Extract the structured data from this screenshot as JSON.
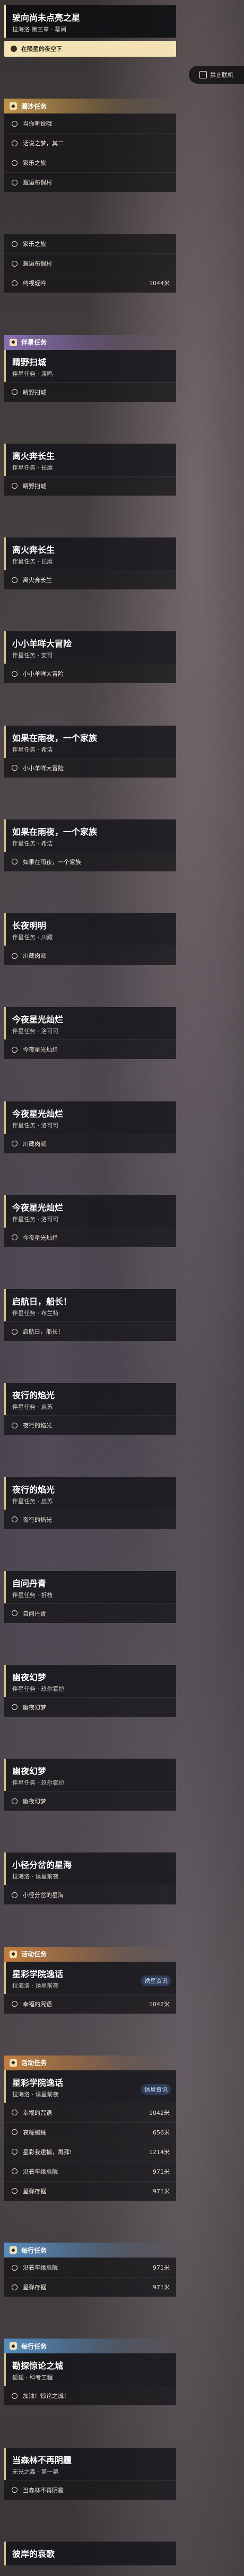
{
  "colors": {
    "accent_gold": "#d9c08a",
    "track_button": "#f3e3b4",
    "header_main": "#e0a94e",
    "header_companion": "#9b7ad0",
    "header_event": "#e08a3a",
    "header_daily": "#5aa0e0"
  },
  "sidebar": {
    "disable_connection_label": "禁止联机"
  },
  "sections": [
    {
      "quest": {
        "title": "驶向尚未点亮之星",
        "sub": "拉海洛 第三章 · 幕间",
        "selected": true
      },
      "track_label": "在陨星的夜空下",
      "objectives": []
    },
    {
      "header": "漏沙任务",
      "header_color": "#e0a94e",
      "objectives": [
        {
          "label": "当你听说哦",
          "dist": ""
        },
        {
          "label": "话说之梦，其二",
          "dist": ""
        },
        {
          "label": "家乐之旅",
          "dist": ""
        },
        {
          "label": "邂逅布偶村",
          "dist": ""
        }
      ]
    },
    {
      "objectives": [
        {
          "label": "家乐之旅",
          "dist": ""
        },
        {
          "label": "邂逅布偶村",
          "dist": ""
        },
        {
          "label": "终视轻吟",
          "dist": "1044米"
        }
      ]
    },
    {
      "header": "伴星任务",
      "header_color": "#9b7ad0",
      "quest": {
        "title": "睛野扫城",
        "sub": "伴星任务 · 渡鸣"
      },
      "objectives": [
        {
          "label": "睛野扫城",
          "dist": ""
        }
      ]
    },
    {
      "quest": {
        "title": "离火奔长生",
        "sub": "伴星任务 · 长鹰"
      },
      "objectives": [
        {
          "label": "睛野扫城",
          "dist": ""
        }
      ]
    },
    {
      "quest": {
        "title": "离火奔长生",
        "sub": "伴星任务 · 长鹰"
      },
      "objectives": [
        {
          "label": "离火奔长生",
          "dist": ""
        }
      ]
    },
    {
      "quest": {
        "title": "小小羊咩大冒险",
        "sub": "伴星任务 · 安可"
      },
      "objectives": [
        {
          "label": "小小羊咩大冒险",
          "dist": ""
        }
      ]
    },
    {
      "quest": {
        "title": "如果在雨夜，一个家族",
        "sub": "伴星任务 · 希洁"
      },
      "objectives": [
        {
          "label": "小小羊咩大冒险",
          "dist": ""
        }
      ]
    },
    {
      "quest": {
        "title": "如果在雨夜，一个家族",
        "sub": "伴星任务 · 希洁"
      },
      "objectives": [
        {
          "label": "如果在雨夜，一个家族",
          "dist": ""
        }
      ]
    },
    {
      "quest": {
        "title": "长夜明明",
        "sub": "伴星任务 · 川藏"
      },
      "objectives": [
        {
          "label": "川藏肉派",
          "dist": ""
        }
      ]
    },
    {
      "quest": {
        "title": "今夜星光灿烂",
        "sub": "伴星任务 · 洛可可"
      },
      "objectives": [
        {
          "label": "今夜星光灿烂",
          "dist": ""
        }
      ]
    },
    {
      "quest": {
        "title": "今夜星光灿烂",
        "sub": "伴星任务 · 洛可可"
      },
      "objectives": [
        {
          "label": "川藏肉派",
          "dist": ""
        }
      ]
    },
    {
      "quest": {
        "title": "今夜星光灿烂",
        "sub": "伴星任务 · 洛可可"
      },
      "objectives": [
        {
          "label": "今夜星光灿烂",
          "dist": ""
        }
      ]
    },
    {
      "quest": {
        "title": "启航日，船长！",
        "sub": "伴星任务 · 布兰特"
      },
      "objectives": [
        {
          "label": "启航日，船长！",
          "dist": ""
        }
      ]
    },
    {
      "quest": {
        "title": "夜行的焰光",
        "sub": "伴星任务 · 启苏"
      },
      "objectives": [
        {
          "label": "夜行的焰光",
          "dist": ""
        }
      ]
    },
    {
      "quest": {
        "title": "夜行的焰光",
        "sub": "伴星任务 · 启苏"
      },
      "objectives": [
        {
          "label": "夜行的焰光",
          "dist": ""
        }
      ]
    },
    {
      "quest": {
        "title": "自问丹青",
        "sub": "伴星任务 · 折枝"
      },
      "objectives": [
        {
          "label": "自问丹青",
          "dist": ""
        }
      ]
    },
    {
      "quest": {
        "title": "幽夜幻梦",
        "sub": "伴星任务 · 玖尔霍拉"
      },
      "objectives": [
        {
          "label": "幽夜幻梦",
          "dist": ""
        }
      ]
    },
    {
      "quest": {
        "title": "幽夜幻梦",
        "sub": "伴星任务 · 玖尔霍拉"
      },
      "objectives": [
        {
          "label": "幽夜幻梦",
          "dist": ""
        }
      ]
    },
    {
      "quest": {
        "title": "小径分岔的星海",
        "sub": "拉海洛 · 诱星前夜"
      },
      "objectives": [
        {
          "label": "小径分岔的星海",
          "dist": ""
        }
      ]
    },
    {
      "header": "活动任务",
      "header_color": "#e08a3a",
      "quest": {
        "title": "星彩学院逸话",
        "sub": "拉海洛 · 诱星前夜",
        "badge": "诱星资讯"
      },
      "objectives": [
        {
          "label": "幸福的咒语",
          "dist": "1042米"
        }
      ]
    },
    {
      "header": "活动任务",
      "header_color": "#e08a3a",
      "quest": {
        "title": "星彩学院逸话",
        "sub": "拉海洛 · 诱星前夜",
        "badge": "诱星资讯"
      },
      "objectives": [
        {
          "label": "幸福的咒语",
          "dist": "1042米"
        },
        {
          "label": "哀嚎蜘蛛",
          "dist": "656米"
        },
        {
          "label": "星彩我逮捕，再拜!",
          "dist": "1214米"
        },
        {
          "label": "沿着年缘启航",
          "dist": "971米"
        },
        {
          "label": "星弹存据",
          "dist": "971米"
        }
      ]
    },
    {
      "header": "每行任务",
      "header_color": "#5aa0e0",
      "objectives": [
        {
          "label": "沿着年缘启航",
          "dist": "971米"
        },
        {
          "label": "星弹存据",
          "dist": "971米"
        }
      ]
    },
    {
      "header": "每行任务",
      "header_color": "#5aa0e0",
      "quest": {
        "title": "勘探惊论之城",
        "sub": "狐狐 · 科考工程"
      },
      "objectives": [
        {
          "label": "加油！惊论之城！",
          "dist": ""
        }
      ]
    },
    {
      "quest": {
        "title": "当森林不再阴霾",
        "sub": "无光之森 · 第一幕"
      },
      "objectives": [
        {
          "label": "当森林不再阴霾",
          "dist": ""
        }
      ]
    },
    {
      "quest": {
        "title": "彼岸的哀歌",
        "sub": ""
      },
      "objectives": []
    }
  ]
}
